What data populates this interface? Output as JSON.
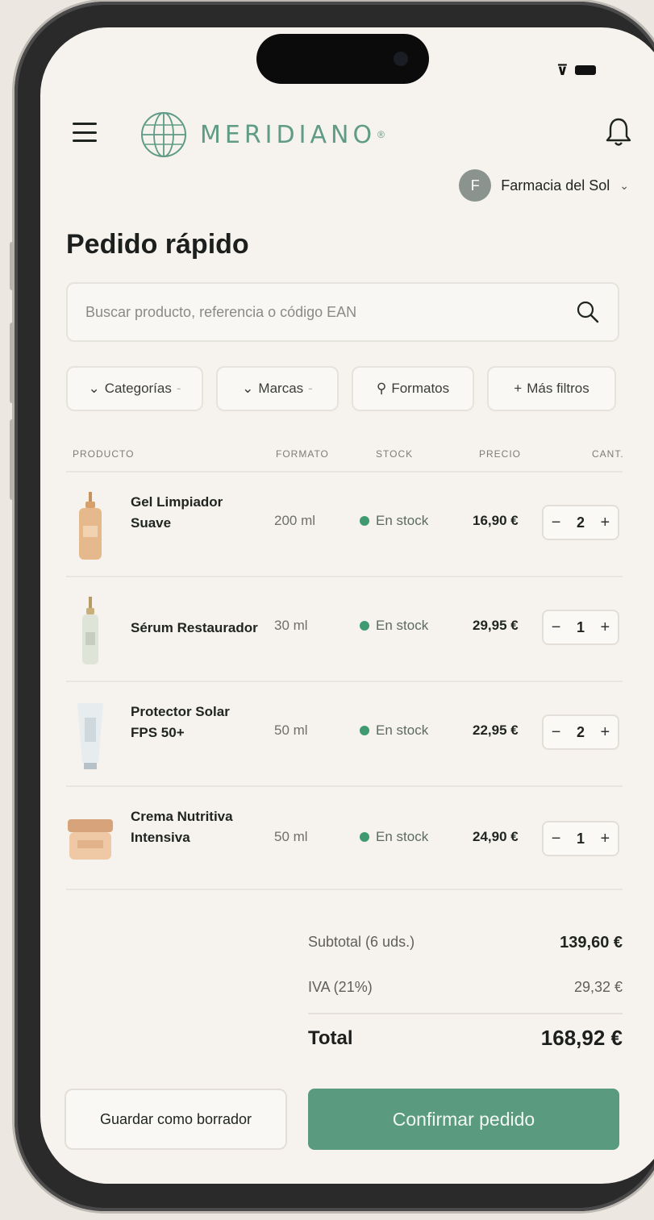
{
  "app": {
    "brand": "MERIDIANO",
    "brand_mark": "®"
  },
  "account": {
    "initial": "F",
    "name": "Farmacia del Sol"
  },
  "page": {
    "title": "Pedido rápido"
  },
  "search": {
    "placeholder": "Buscar producto, referencia o código EAN"
  },
  "filters": [
    {
      "icon": "⌄",
      "label": "Categorías"
    },
    {
      "icon": "⌄",
      "label": "Marcas"
    },
    {
      "icon": "⚲",
      "label": "Formatos"
    },
    {
      "icon": "+",
      "label": "Más filtros"
    }
  ],
  "table": {
    "headers": {
      "product": "PRODUCTO",
      "format": "FORMATO",
      "stock": "STOCK",
      "price": "PRECIO",
      "qty": "CANT."
    },
    "rows": [
      {
        "name_line1": "Gel Limpiador",
        "name_line2": "Suave",
        "format": "200 ml",
        "stock": "En stock",
        "price": "16,90 €",
        "qty": "2"
      },
      {
        "name_line1": "Sérum Restaurador",
        "name_line2": "",
        "format": "30 ml",
        "stock": "En stock",
        "price": "29,95 €",
        "qty": "1"
      },
      {
        "name_line1": "Protector Solar",
        "name_line2": "FPS 50+",
        "format": "50 ml",
        "stock": "En stock",
        "price": "22,95 €",
        "qty": "2"
      },
      {
        "name_line1": "Crema Nutritiva",
        "name_line2": "Intensiva",
        "format": "50 ml",
        "stock": "En stock",
        "price": "24,90 €",
        "qty": "1"
      }
    ]
  },
  "totals": {
    "subtotal_label": "Subtotal (6 uds.)",
    "subtotal": "139,60 €",
    "iva_label": "IVA (21%)",
    "iva": "29,32 €",
    "total_label": "Total",
    "total": "168,92 €"
  },
  "actions": {
    "draft": "Guardar como borrador",
    "confirm": "Confirmar pedido"
  },
  "colors": {
    "accent": "#5a9a7f",
    "stock": "#3f9a72",
    "brand": "#5f9b86",
    "background": "#f6f3ee"
  }
}
